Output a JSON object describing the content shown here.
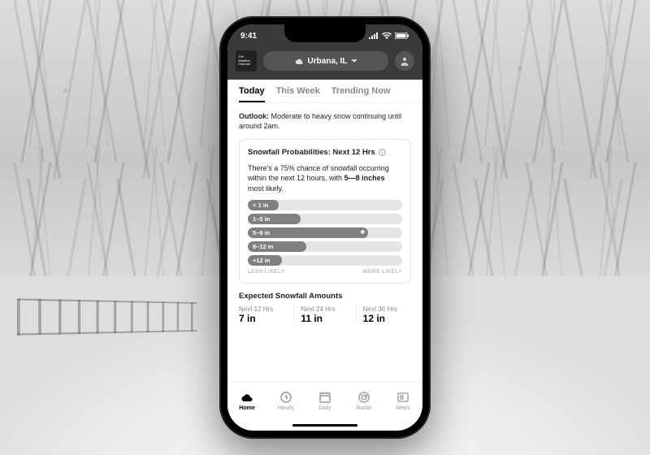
{
  "status": {
    "time": "9:41"
  },
  "brand": {
    "line1": "The",
    "line2": "Weather",
    "line3": "Channel"
  },
  "location": {
    "name": "Urbana, IL"
  },
  "top_tabs": [
    {
      "label": "Today",
      "active": true
    },
    {
      "label": "This Week",
      "active": false
    },
    {
      "label": "Trending Now",
      "active": false
    }
  ],
  "outlook": {
    "prefix": "Outlook:",
    "text": "Moderate to heavy snow continuing until around 2am."
  },
  "prob_card": {
    "title": "Snowfall Probabilities: Next 12 Hrs",
    "desc_before": "There's a 75% chance of snowfall occurring within the next 12 hours, with ",
    "desc_bold": "5—8 inches",
    "desc_after": " most likely.",
    "rows": [
      {
        "label": "< 1 in",
        "pct": 20,
        "highlight": false
      },
      {
        "label": "1–5 in",
        "pct": 34,
        "highlight": false
      },
      {
        "label": "5–8 in",
        "pct": 78,
        "highlight": true
      },
      {
        "label": "8–12 in",
        "pct": 38,
        "highlight": false
      },
      {
        "label": "+12 in",
        "pct": 22,
        "highlight": false
      }
    ],
    "less": "LESS LIKELY",
    "more": "MORE LIKELY"
  },
  "expected": {
    "title": "Expected Snowfall Amounts",
    "cols": [
      {
        "label": "Next 12 Hrs",
        "value": "7 in"
      },
      {
        "label": "Next 24 Hrs",
        "value": "11 in"
      },
      {
        "label": "Next 36 Hrs",
        "value": "12 in"
      }
    ]
  },
  "nav": [
    {
      "label": "Home",
      "icon": "cloud",
      "active": true
    },
    {
      "label": "Hourly",
      "icon": "clock",
      "active": false
    },
    {
      "label": "Daily",
      "icon": "calendar",
      "active": false
    },
    {
      "label": "Radar",
      "icon": "radar",
      "active": false
    },
    {
      "label": "News",
      "icon": "news",
      "active": false
    }
  ]
}
